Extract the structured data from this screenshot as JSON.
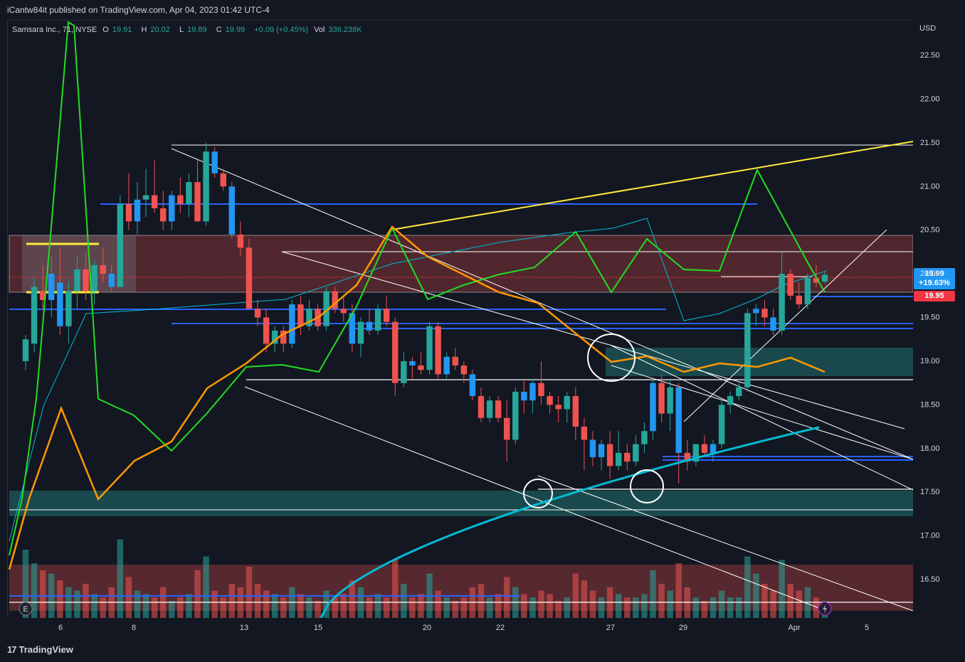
{
  "header": {
    "publish_line": "iCantw84it published on TradingView.com, Apr 04, 2023 01:42 UTC-4"
  },
  "legend": {
    "symbol": "Samsara Inc., 71, NYSE",
    "open_key": "O",
    "open": "19.91",
    "high_key": "H",
    "high": "20.02",
    "low_key": "L",
    "low": "19.89",
    "close_key": "C",
    "close": "19.99",
    "change": "+0.09 (+0.45%)",
    "vol_key": "Vol",
    "vol": "336.238K"
  },
  "axis": {
    "currency": "USD",
    "price_labels": [
      "22.50",
      "22.00",
      "21.50",
      "21.00",
      "20.50",
      "20.00",
      "19.50",
      "19.00",
      "18.50",
      "18.00",
      "17.50",
      "17.00",
      "16.50"
    ],
    "date_labels": [
      "6",
      "8",
      "13",
      "15",
      "20",
      "22",
      "27",
      "29",
      "Apr",
      "5"
    ]
  },
  "price_tags": {
    "last": "19.99",
    "last_pct": "+19.63%",
    "close": "19.95"
  },
  "footer": {
    "brand": "TradingView",
    "brand_mark": "17"
  },
  "markers": {
    "earnings": "E"
  },
  "colors": {
    "up": "#26a69a",
    "down": "#ef5350",
    "accent_blue": "#2196f3",
    "green_line": "#22dd22",
    "orange_line": "#ff9800",
    "cyan_line": "#00bcd4",
    "yellow_line": "#ffeb3b"
  },
  "chart_data": {
    "type": "candlestick",
    "symbol": "Samsara Inc.",
    "interval": "71",
    "exchange": "NYSE",
    "ylim": [
      16.1,
      22.75
    ],
    "x_ticks": [
      "6",
      "8",
      "13",
      "15",
      "20",
      "22",
      "27",
      "29",
      "Apr",
      "5"
    ],
    "y_ticks": [
      16.5,
      17.0,
      17.5,
      18.0,
      18.5,
      19.0,
      19.5,
      20.0,
      20.5,
      21.0,
      21.5,
      22.0,
      22.5
    ],
    "last_close": 19.99,
    "candles": [
      [
        19.0,
        19.3,
        18.9,
        19.25
      ],
      [
        19.2,
        19.95,
        19.1,
        19.85
      ],
      [
        19.8,
        20.1,
        19.6,
        19.7
      ],
      [
        19.7,
        20.2,
        19.5,
        20.0
      ],
      [
        19.9,
        20.3,
        19.3,
        19.4
      ],
      [
        19.4,
        19.9,
        19.2,
        19.8
      ],
      [
        19.8,
        20.2,
        19.6,
        20.05
      ],
      [
        20.05,
        20.25,
        19.7,
        19.8
      ],
      [
        19.8,
        20.15,
        19.65,
        20.1
      ],
      [
        20.1,
        20.3,
        19.9,
        20.0
      ],
      [
        20.0,
        20.1,
        19.8,
        19.85
      ],
      [
        19.85,
        20.9,
        19.85,
        20.8
      ],
      [
        20.8,
        21.15,
        20.5,
        20.6
      ],
      [
        20.6,
        21.05,
        20.45,
        20.85
      ],
      [
        20.85,
        21.2,
        20.65,
        20.9
      ],
      [
        20.9,
        21.3,
        20.7,
        20.75
      ],
      [
        20.75,
        20.95,
        20.5,
        20.6
      ],
      [
        20.6,
        20.95,
        20.5,
        20.9
      ],
      [
        20.9,
        21.1,
        20.7,
        20.8
      ],
      [
        20.8,
        21.15,
        20.65,
        21.05
      ],
      [
        21.05,
        21.3,
        20.8,
        20.6
      ],
      [
        20.6,
        21.5,
        20.55,
        21.4
      ],
      [
        21.4,
        21.45,
        21.1,
        21.15
      ],
      [
        21.15,
        21.2,
        20.95,
        21.0
      ],
      [
        21.0,
        21.05,
        20.4,
        20.45
      ],
      [
        20.45,
        20.6,
        20.2,
        20.3
      ],
      [
        20.3,
        20.4,
        19.6,
        19.6
      ],
      [
        19.6,
        19.7,
        19.4,
        19.5
      ],
      [
        19.5,
        19.6,
        19.1,
        19.2
      ],
      [
        19.2,
        19.4,
        19.1,
        19.35
      ],
      [
        19.35,
        19.4,
        19.1,
        19.2
      ],
      [
        19.2,
        19.7,
        19.15,
        19.65
      ],
      [
        19.65,
        19.75,
        19.3,
        19.4
      ],
      [
        19.4,
        19.7,
        19.35,
        19.6
      ],
      [
        19.6,
        19.65,
        19.35,
        19.4
      ],
      [
        19.4,
        19.85,
        19.35,
        19.8
      ],
      [
        19.8,
        19.85,
        19.55,
        19.6
      ],
      [
        19.6,
        19.75,
        19.45,
        19.55
      ],
      [
        19.55,
        19.65,
        19.1,
        19.2
      ],
      [
        19.2,
        19.5,
        19.05,
        19.45
      ],
      [
        19.45,
        19.6,
        19.3,
        19.35
      ],
      [
        19.35,
        19.65,
        19.3,
        19.6
      ],
      [
        19.6,
        19.75,
        19.4,
        19.45
      ],
      [
        19.45,
        19.5,
        18.6,
        18.75
      ],
      [
        18.75,
        19.1,
        18.7,
        19.0
      ],
      [
        19.0,
        19.05,
        18.8,
        18.95
      ],
      [
        18.95,
        19.1,
        18.85,
        18.9
      ],
      [
        18.9,
        19.45,
        18.85,
        19.4
      ],
      [
        19.4,
        19.45,
        18.8,
        18.85
      ],
      [
        18.85,
        19.1,
        18.8,
        19.05
      ],
      [
        19.05,
        19.15,
        18.9,
        18.95
      ],
      [
        18.95,
        19.0,
        18.75,
        18.85
      ],
      [
        18.85,
        18.9,
        18.55,
        18.6
      ],
      [
        18.6,
        18.7,
        18.3,
        18.35
      ],
      [
        18.35,
        18.6,
        18.3,
        18.55
      ],
      [
        18.55,
        18.6,
        18.3,
        18.35
      ],
      [
        18.35,
        18.55,
        17.85,
        18.1
      ],
      [
        18.1,
        18.7,
        18.05,
        18.65
      ],
      [
        18.65,
        18.8,
        18.4,
        18.55
      ],
      [
        18.55,
        18.8,
        18.4,
        18.75
      ],
      [
        18.75,
        19.0,
        18.5,
        18.6
      ],
      [
        18.6,
        18.65,
        18.4,
        18.5
      ],
      [
        18.5,
        18.6,
        18.3,
        18.45
      ],
      [
        18.45,
        18.65,
        18.3,
        18.6
      ],
      [
        18.6,
        18.7,
        18.1,
        18.25
      ],
      [
        18.25,
        18.35,
        17.75,
        18.1
      ],
      [
        18.1,
        18.2,
        17.8,
        17.9
      ],
      [
        17.9,
        18.1,
        17.75,
        18.05
      ],
      [
        18.05,
        18.2,
        17.65,
        17.8
      ],
      [
        17.8,
        18.2,
        17.75,
        17.95
      ],
      [
        17.95,
        18.05,
        17.75,
        17.85
      ],
      [
        17.85,
        18.15,
        17.8,
        18.05
      ],
      [
        18.05,
        18.3,
        17.95,
        18.2
      ],
      [
        18.2,
        18.8,
        18.1,
        18.75
      ],
      [
        18.75,
        18.85,
        18.3,
        18.4
      ],
      [
        18.4,
        18.8,
        18.2,
        18.7
      ],
      [
        18.7,
        18.75,
        17.6,
        17.95
      ],
      [
        17.95,
        18.1,
        17.75,
        17.85
      ],
      [
        17.85,
        18.05,
        17.8,
        18.05
      ],
      [
        18.05,
        18.15,
        17.9,
        17.95
      ],
      [
        17.95,
        18.1,
        17.85,
        18.05
      ],
      [
        18.05,
        18.55,
        18.0,
        18.5
      ],
      [
        18.5,
        18.65,
        18.4,
        18.6
      ],
      [
        18.6,
        18.75,
        18.55,
        18.7
      ],
      [
        18.7,
        19.6,
        18.65,
        19.55
      ],
      [
        19.55,
        19.65,
        19.4,
        19.6
      ],
      [
        19.6,
        19.7,
        19.4,
        19.5
      ],
      [
        19.5,
        19.6,
        19.3,
        19.35
      ],
      [
        19.35,
        20.25,
        19.3,
        20.0
      ],
      [
        20.0,
        20.05,
        19.7,
        19.75
      ],
      [
        19.75,
        19.9,
        19.6,
        19.65
      ],
      [
        19.65,
        20.0,
        19.6,
        19.95
      ],
      [
        19.95,
        20.1,
        19.85,
        19.9
      ],
      [
        19.91,
        20.02,
        19.89,
        19.99
      ]
    ],
    "volume": [
      2.0,
      1.6,
      1.4,
      1.3,
      1.1,
      0.9,
      0.8,
      1.0,
      0.7,
      0.6,
      0.9,
      2.3,
      1.2,
      0.8,
      0.7,
      0.6,
      0.9,
      0.5,
      0.6,
      0.7,
      1.4,
      1.8,
      0.8,
      0.6,
      1.0,
      0.9,
      1.5,
      1.0,
      0.8,
      0.7,
      0.6,
      0.9,
      0.7,
      0.6,
      0.5,
      0.8,
      0.6,
      0.7,
      1.1,
      0.9,
      0.6,
      0.7,
      0.6,
      1.7,
      1.0,
      0.6,
      0.7,
      1.3,
      0.8,
      0.6,
      0.5,
      0.6,
      0.9,
      1.0,
      0.6,
      0.7,
      1.2,
      0.9,
      0.7,
      0.6,
      0.8,
      0.7,
      0.5,
      0.6,
      1.3,
      1.1,
      0.8,
      0.6,
      0.9,
      0.7,
      0.6,
      0.6,
      0.7,
      1.4,
      1.0,
      0.8,
      1.6,
      0.9,
      0.6,
      0.5,
      0.6,
      0.8,
      0.6,
      0.6,
      1.8,
      1.3,
      1.0,
      0.8,
      1.7,
      1.0,
      0.8,
      0.9,
      0.6,
      0.5
    ]
  }
}
